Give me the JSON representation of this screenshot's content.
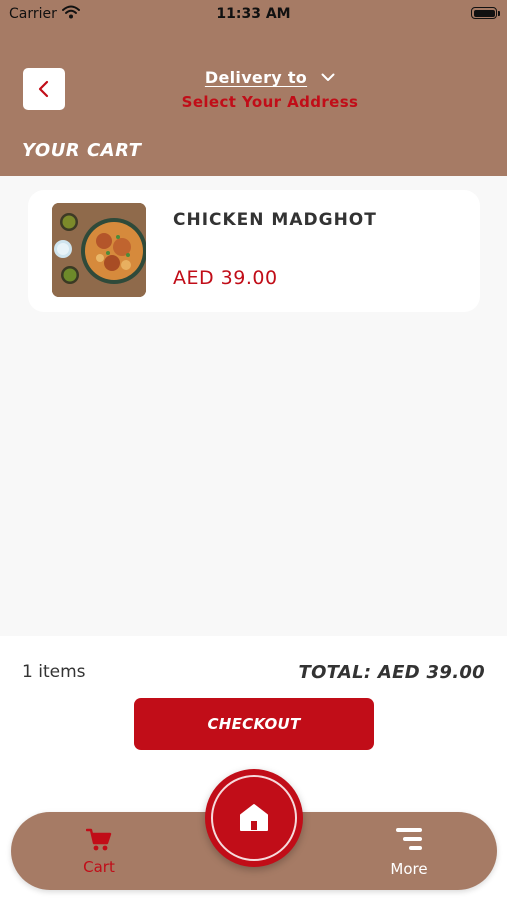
{
  "status_bar": {
    "carrier": "Carrier",
    "time": "11:33 AM"
  },
  "header": {
    "delivery_label": "Delivery to",
    "address_label": "Select Your Address",
    "cart_title": "YOUR CART"
  },
  "cart": {
    "items": [
      {
        "name": "CHICKEN MADGHOT",
        "price": "AED 39.00"
      }
    ]
  },
  "summary": {
    "items_count": "1 items",
    "total": "TOTAL: AED 39.00",
    "checkout_label": "CHECKOUT"
  },
  "bottom_nav": {
    "cart_label": "Cart",
    "more_label": "More"
  },
  "colors": {
    "brand_brown": "#a67b65",
    "accent_red": "#c10d18",
    "background": "#f8f8f8"
  }
}
